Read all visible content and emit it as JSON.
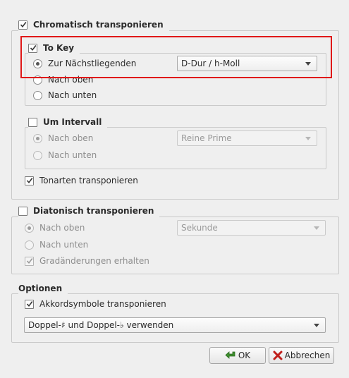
{
  "chromatic": {
    "label": "Chromatisch transponieren",
    "checked": true,
    "to_key": {
      "label": "To Key",
      "checked": true,
      "options": [
        "Zur Nächstliegenden",
        "Nach oben",
        "Nach unten"
      ],
      "selected": "Zur Nächstliegenden",
      "key_value": "D-Dur / h-Moll"
    },
    "interval": {
      "label": "Um Intervall",
      "checked": false,
      "options": [
        "Nach oben",
        "Nach unten"
      ],
      "selected": "Nach oben",
      "interval_value": "Reine Prime"
    },
    "transpose_keys": {
      "label": "Tonarten transponieren",
      "checked": true
    }
  },
  "diatonic": {
    "label": "Diatonisch transponieren",
    "checked": false,
    "options": [
      "Nach oben",
      "Nach unten"
    ],
    "selected": "Nach oben",
    "interval_value": "Sekunde",
    "keep_degree": {
      "label": "Gradänderungen erhalten",
      "checked": true
    }
  },
  "options": {
    "title": "Optionen",
    "chord_symbols": {
      "label": "Akkordsymbole transponieren",
      "checked": true
    },
    "accidentals_value": "Doppel-♯ und Doppel-♭ verwenden"
  },
  "buttons": {
    "ok_label": "OK",
    "cancel_label": "Abbrechen"
  },
  "colors": {
    "highlight": "#e01818",
    "ok_icon": "#3f8f2f",
    "cancel_icon": "#c0201c"
  }
}
